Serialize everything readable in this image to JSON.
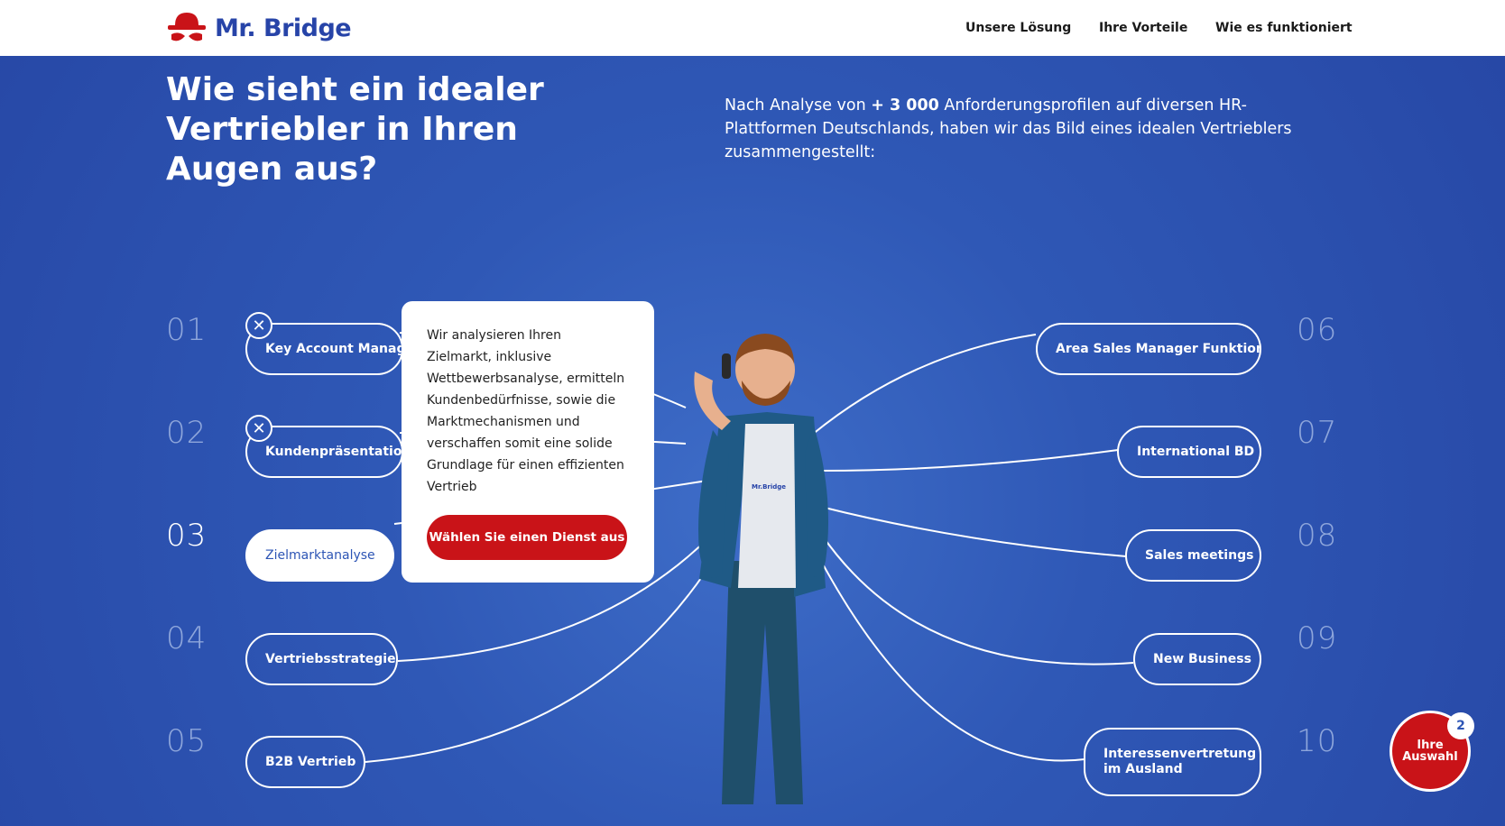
{
  "header": {
    "logo_text": "Mr. Bridge",
    "nav": [
      "Unsere Lösung",
      "Ihre Vorteile",
      "Wie es funktioniert"
    ]
  },
  "hero": {
    "headline": "Wie sieht ein idealer Vertriebler in Ihren Augen aus?",
    "intro_prefix": "Nach Analyse von ",
    "intro_number": "+ 3 000",
    "intro_suffix": "  Anforderungsprofilen auf diversen HR-Plattformen Deutschlands, haben wir das Bild eines idealen Vertrieblers zusammengestellt:",
    "shirt_logo": "Mr.Bridge"
  },
  "skills_left": [
    {
      "num": "01",
      "label": "Key Account Manager",
      "selected": true
    },
    {
      "num": "02",
      "label": "Kundenpräsentationen",
      "selected": true
    },
    {
      "num": "03",
      "label": "Zielmarktanalyse",
      "active": true
    },
    {
      "num": "04",
      "label": "Vertriebsstrategie"
    },
    {
      "num": "05",
      "label": "B2B Vertrieb"
    }
  ],
  "skills_right": [
    {
      "num": "06",
      "label": "Area Sales Manager Funktion"
    },
    {
      "num": "07",
      "label": "International BD"
    },
    {
      "num": "08",
      "label": "Sales meetings"
    },
    {
      "num": "09",
      "label": "New Business"
    },
    {
      "num": "10",
      "label": "Interessenvertretung im Ausland"
    }
  ],
  "popup": {
    "text": "Wir analysieren Ihren Zielmarkt, inklusive Wettbewerbsanalyse, ermitteln Kundenbedürfnisse, sowie die Marktmechanismen und verschaffen somit eine solide Grundlage für einen effizienten Vertrieb",
    "button": "Wählen Sie einen Dienst aus"
  },
  "choice": {
    "line1": "Ihre",
    "line2": "Auswahl",
    "count": "2"
  },
  "colors": {
    "brand_blue": "#2744a8",
    "hero_bg": "#2d55b5",
    "accent_red": "#c91318"
  }
}
